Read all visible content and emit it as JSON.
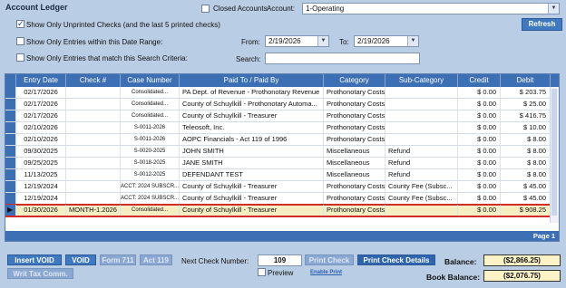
{
  "header": {
    "title": "Account Ledger",
    "closed_accounts_label": "Closed Accounts",
    "account_label": "Account:",
    "account_value": "1-Operating",
    "refresh_label": "Refresh"
  },
  "filters": {
    "show_unprinted_label": "Show Only Unprinted Checks (and the last 5 printed checks)",
    "show_unprinted_checked": true,
    "date_range_label": "Show Only Entries within this Date Range:",
    "search_criteria_label": "Show Only Entries that match this Search Criteria:",
    "from_label": "From:",
    "from_value": "2/19/2026",
    "to_label": "To:",
    "to_value": "2/19/2026",
    "search_label": "Search:",
    "search_value": ""
  },
  "grid": {
    "columns": [
      "Entry Date",
      "Check #",
      "Case Number",
      "Paid To / Paid By",
      "Category",
      "Sub-Category",
      "Credit",
      "Debit"
    ],
    "rows": [
      {
        "date": "02/17/2026",
        "check": "",
        "case": "Consolidated...",
        "paid": "PA Dept. of Revenue - Prothonotary Revenue",
        "cat": "Prothonotary Costs",
        "sub": "",
        "credit": "$ 0.00",
        "debit": "$ 203.75"
      },
      {
        "date": "02/17/2026",
        "check": "",
        "case": "Consolidated...",
        "paid": "County of Schuylkill - Prothonotary Automa...",
        "cat": "Prothonotary Costs",
        "sub": "",
        "credit": "$ 0.00",
        "debit": "$ 25.00"
      },
      {
        "date": "02/17/2026",
        "check": "",
        "case": "Consolidated...",
        "paid": "County of Schuylkill - Treasurer",
        "cat": "Prothonotary Costs",
        "sub": "",
        "credit": "$ 0.00",
        "debit": "$ 416.75"
      },
      {
        "date": "02/10/2026",
        "check": "",
        "case": "S-0011-2026",
        "paid": "Teleosoft, Inc.",
        "cat": "Prothonotary Costs",
        "sub": "",
        "credit": "$ 0.00",
        "debit": "$ 10.00"
      },
      {
        "date": "02/10/2026",
        "check": "",
        "case": "S-0011-2026",
        "paid": "AOPC Financials - Act 119 of 1996",
        "cat": "Prothonotary Costs",
        "sub": "",
        "credit": "$ 0.00",
        "debit": "$ 8.00"
      },
      {
        "date": "09/30/2025",
        "check": "",
        "case": "S-0020-2025",
        "paid": "JOHN SMITH",
        "cat": "Miscellaneous",
        "sub": "Refund",
        "credit": "$ 0.00",
        "debit": "$ 8.00"
      },
      {
        "date": "09/25/2025",
        "check": "",
        "case": "S-0018-2025",
        "paid": "JANE SMITH",
        "cat": "Miscellaneous",
        "sub": "Refund",
        "credit": "$ 0.00",
        "debit": "$ 8.00"
      },
      {
        "date": "11/13/2025",
        "check": "",
        "case": "S-0012-2025",
        "paid": "DEFENDANT TEST",
        "cat": "Miscellaneous",
        "sub": "Refund",
        "credit": "$ 0.00",
        "debit": "$ 8.00"
      },
      {
        "date": "12/19/2024",
        "check": "",
        "case": "ACCT: 2024 SUBSCR...",
        "paid": "County of Schuylkill - Treasurer",
        "cat": "Prothonotary Costs",
        "sub": "County Fee (Subsc...",
        "credit": "$ 0.00",
        "debit": "$ 45.00"
      },
      {
        "date": "12/19/2024",
        "check": "",
        "case": "ACCT: 2024 SUBSCR...",
        "paid": "County of Schuylkill - Treasurer",
        "cat": "Prothonotary Costs",
        "sub": "County Fee (Subsc...",
        "credit": "$ 0.00",
        "debit": "$ 45.00"
      },
      {
        "date": "01/30/2026",
        "check": "MONTH-1.2026",
        "case": "Consolidated...",
        "paid": "County of Schuylkill - Treasurer",
        "cat": "Prothonotary Costs",
        "sub": "",
        "credit": "$ 0.00",
        "debit": "$ 908.25",
        "selected": true
      }
    ],
    "pager": "Page 1"
  },
  "footer": {
    "insert_void": "Insert VOID",
    "void": "VOID",
    "form711": "Form 711",
    "act119": "Act 119",
    "writ_tax": "Writ Tax Comm.",
    "next_check_label": "Next Check Number:",
    "next_check_value": "109",
    "print_check": "Print Check",
    "print_check_details": "Print Check Details",
    "preview_label": "Preview",
    "enable_print": "Enable Print",
    "balance_label": "Balance:",
    "balance_value": "($2,866.25)",
    "book_balance_label": "Book Balance:",
    "book_balance_value": "($2,076.75)"
  },
  "colors": {
    "background": "#b9cde4",
    "header_blue": "#3c6fb4",
    "selected_row": "#f6eec3",
    "selection_outline": "#d32a2a"
  }
}
